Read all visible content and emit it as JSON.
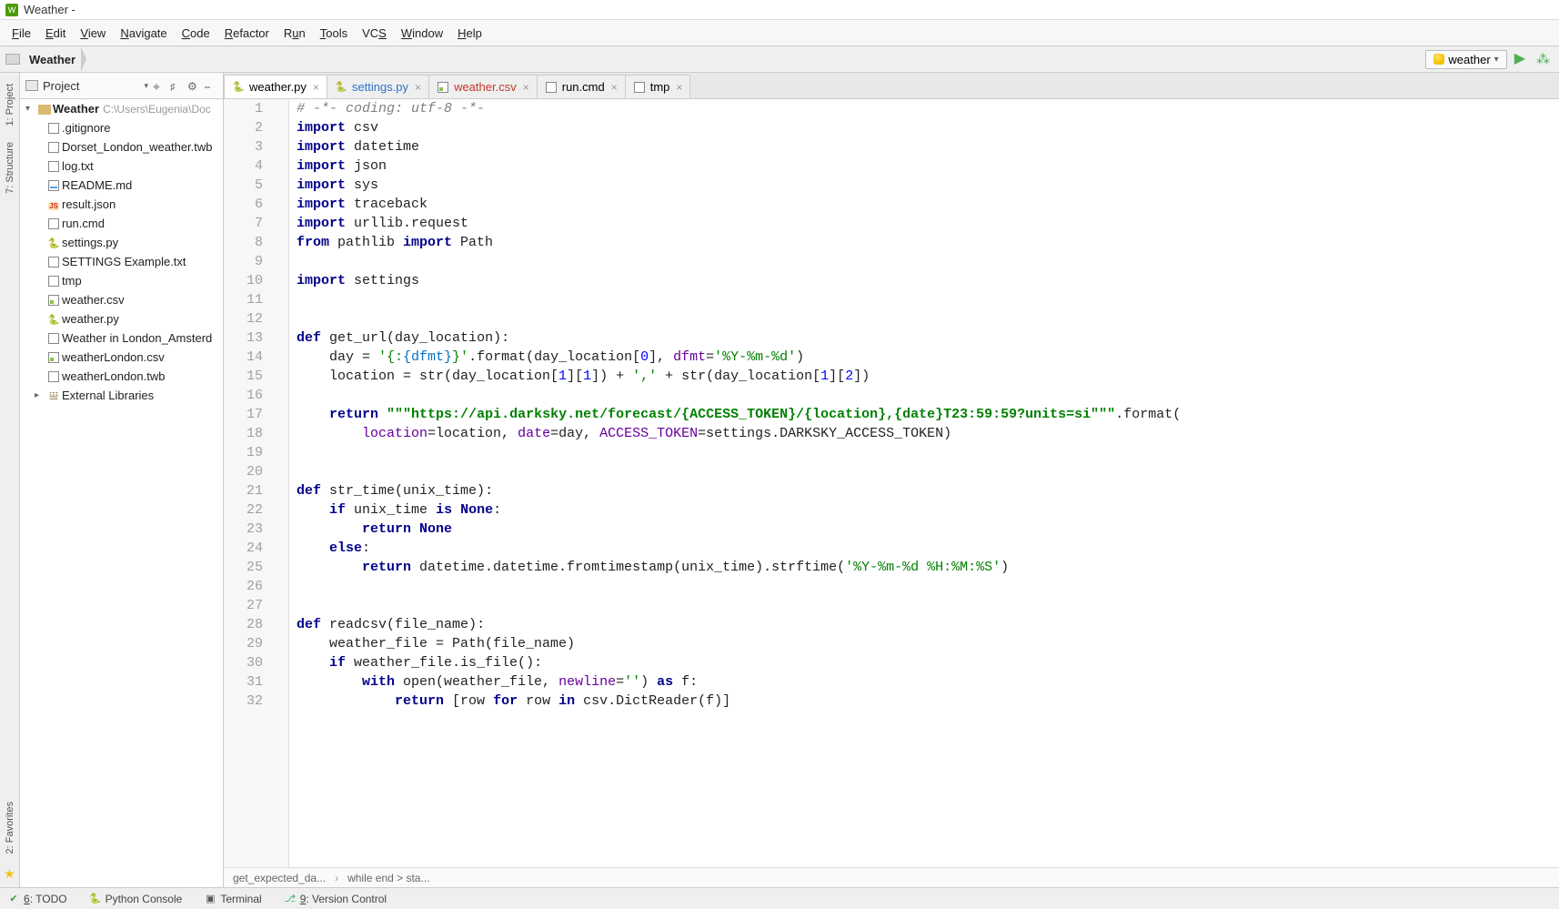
{
  "window": {
    "title": "Weather -"
  },
  "menu": {
    "items": [
      "File",
      "Edit",
      "View",
      "Navigate",
      "Code",
      "Refactor",
      "Run",
      "Tools",
      "VCS",
      "Window",
      "Help"
    ]
  },
  "breadcrumb": {
    "segments": [
      "Weather"
    ]
  },
  "run_config": {
    "name": "weather"
  },
  "project_panel": {
    "title": "Project",
    "root": {
      "name": "Weather",
      "path": "C:\\Users\\Eugenia\\Doc"
    },
    "files": [
      {
        "name": ".gitignore",
        "icon": "txt",
        "style": ""
      },
      {
        "name": "Dorset_London_weather.twb",
        "icon": "txt",
        "style": ""
      },
      {
        "name": "log.txt",
        "icon": "txt",
        "style": ""
      },
      {
        "name": "README.md",
        "icon": "md",
        "style": ""
      },
      {
        "name": "result.json",
        "icon": "json",
        "style": "link"
      },
      {
        "name": "run.cmd",
        "icon": "txt",
        "style": ""
      },
      {
        "name": "settings.py",
        "icon": "py",
        "style": "link"
      },
      {
        "name": "SETTINGS Example.txt",
        "icon": "txt",
        "style": ""
      },
      {
        "name": "tmp",
        "icon": "txt",
        "style": ""
      },
      {
        "name": "weather.csv",
        "icon": "csv",
        "style": "csv"
      },
      {
        "name": "weather.py",
        "icon": "py",
        "style": ""
      },
      {
        "name": "Weather in London_Amsterd",
        "icon": "txt",
        "style": ""
      },
      {
        "name": "weatherLondon.csv",
        "icon": "csv",
        "style": "twb"
      },
      {
        "name": "weatherLondon.twb",
        "icon": "txt",
        "style": "twb"
      }
    ],
    "external": "External Libraries"
  },
  "tabs": [
    {
      "label": "weather.py",
      "icon": "py",
      "active": true,
      "style": ""
    },
    {
      "label": "settings.py",
      "icon": "py",
      "active": false,
      "style": "link"
    },
    {
      "label": "weather.csv",
      "icon": "csv",
      "active": false,
      "style": "csv"
    },
    {
      "label": "run.cmd",
      "icon": "cmd",
      "active": false,
      "style": ""
    },
    {
      "label": "tmp",
      "icon": "txt",
      "active": false,
      "style": ""
    }
  ],
  "editor": {
    "first_line": 1,
    "last_line": 32
  },
  "editor_breadcrumb": {
    "items": [
      "get_expected_da...",
      "while end > sta..."
    ]
  },
  "bottom_tools": [
    {
      "label": "6: TODO",
      "icon": "todo"
    },
    {
      "label": "Python Console",
      "icon": "py"
    },
    {
      "label": "Terminal",
      "icon": "term"
    },
    {
      "label": "9: Version Control",
      "icon": "vc"
    }
  ],
  "left_tabs": {
    "a": "1: Project",
    "b": "7: Structure",
    "c": "2: Favorites"
  }
}
